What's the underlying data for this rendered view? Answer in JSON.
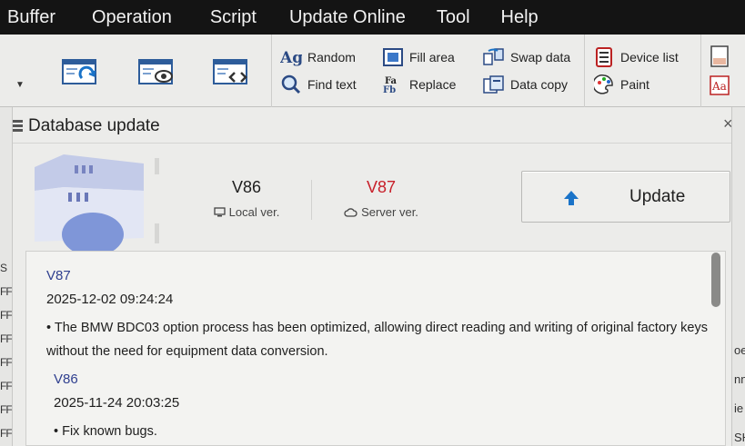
{
  "menubar": {
    "items": [
      "Buffer",
      "Operation",
      "Script",
      "Update Online",
      "Tool",
      "Help"
    ]
  },
  "ribbon": {
    "dropdown_icon": "chevron-down-icon",
    "big_icons": [
      "window-refresh-icon",
      "window-view-icon",
      "window-code-icon"
    ],
    "tools": [
      {
        "label": "Random",
        "icon": "ag-random-icon"
      },
      {
        "label": "Find text",
        "icon": "magnifier-icon"
      },
      {
        "label": "Fill area",
        "icon": "fill-area-icon"
      },
      {
        "label": "Replace",
        "icon": "replace-icon"
      },
      {
        "label": "Swap data",
        "icon": "swap-icon"
      },
      {
        "label": "Data copy",
        "icon": "data-copy-icon"
      },
      {
        "label": "Device list",
        "icon": "device-list-icon"
      },
      {
        "label": "Paint",
        "icon": "palette-icon"
      }
    ]
  },
  "dialog": {
    "title": "Database update",
    "close_label": "×",
    "local": {
      "version": "V86",
      "label": "Local ver."
    },
    "server": {
      "version": "V87",
      "label": "Server ver.",
      "color": "#c8202a"
    },
    "update_button": "Update",
    "notes": [
      {
        "version": "V87",
        "date": "2025-12-02 09:24:24",
        "text": "• The BMW BDC03 option process has been optimized, allowing direct reading and writing of original factory keys without the need for equipment data conversion."
      },
      {
        "version": "V86",
        "date": "2025-11-24 20:03:25",
        "text": "• Fix known bugs."
      }
    ]
  },
  "side_fragments": {
    "left": [
      "S",
      "FF",
      "FF",
      "FF",
      "FF",
      "FF",
      "FF",
      "FF"
    ],
    "right": [
      "oe",
      "nn",
      "ie",
      "SH"
    ]
  },
  "colors": {
    "menubar": "#141414",
    "accent_blue": "#1a73c8",
    "server_version_red": "#c8202a",
    "note_version_blue": "#2f3f8f"
  }
}
